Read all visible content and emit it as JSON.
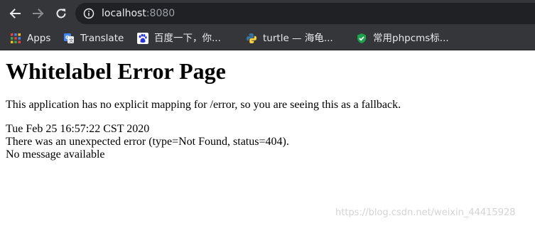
{
  "browser": {
    "url_host": "localhost",
    "url_port": ":8080"
  },
  "bookmarks": [
    {
      "label": "Apps",
      "icon": "apps-grid-icon"
    },
    {
      "label": "Translate",
      "icon": "translate-icon"
    },
    {
      "label": "百度一下，你...",
      "icon": "baidu-paw-icon"
    },
    {
      "label": "turtle — 海龟...",
      "icon": "python-icon"
    },
    {
      "label": "常用phpcms标...",
      "icon": "green-check-icon"
    }
  ],
  "page": {
    "title": "Whitelabel Error Page",
    "explanation": "This application has no explicit mapping for /error, so you are seeing this as a fallback.",
    "timestamp": "Tue Feb 25 16:57:22 CST 2020",
    "error_line": "There was an unexpected error (type=Not Found, status=404).",
    "message": "No message available"
  },
  "watermark": "https://blog.csdn.net/weixin_44415928",
  "colors": {
    "toolbar": "#35363a",
    "omnibox": "#202124",
    "page_bg": "#ffffff"
  }
}
